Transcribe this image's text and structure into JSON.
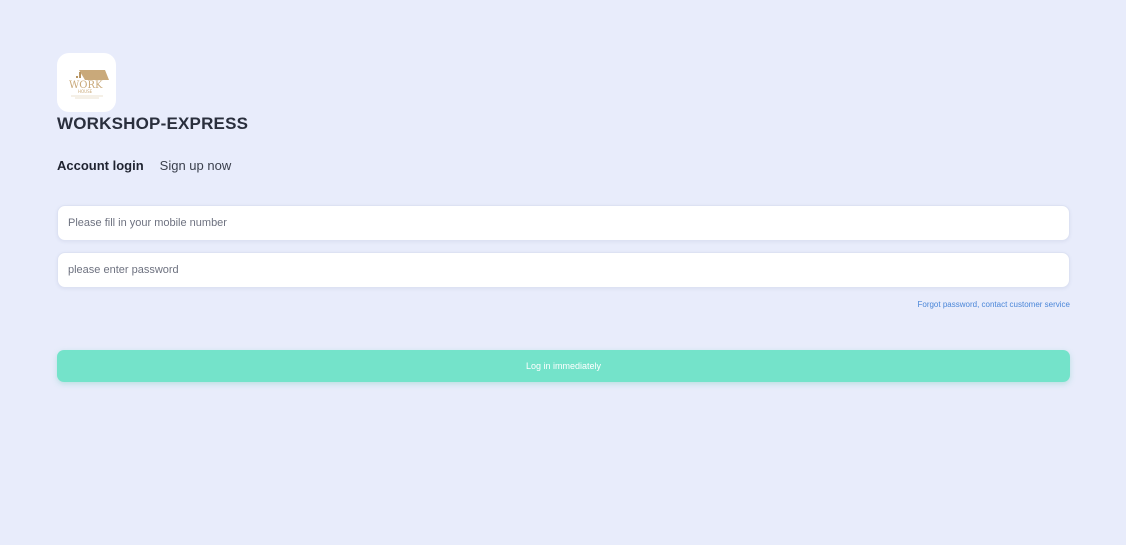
{
  "app": {
    "title": "WORKSHOP-EXPRESS",
    "logo_icon": "work-house-logo"
  },
  "tabs": [
    {
      "label": "Account login",
      "active": true
    },
    {
      "label": "Sign up now",
      "active": false
    }
  ],
  "form": {
    "phone": {
      "value": "",
      "placeholder": "Please fill in your mobile number"
    },
    "password": {
      "value": "",
      "placeholder": "please enter password"
    },
    "forgot_label": "Forgot password, contact customer service",
    "submit_label": "Log in immediately"
  },
  "colors": {
    "background": "#e8ecfb",
    "accent": "#74e3ca",
    "link": "#4a86d8",
    "title": "#2a2f3d"
  }
}
